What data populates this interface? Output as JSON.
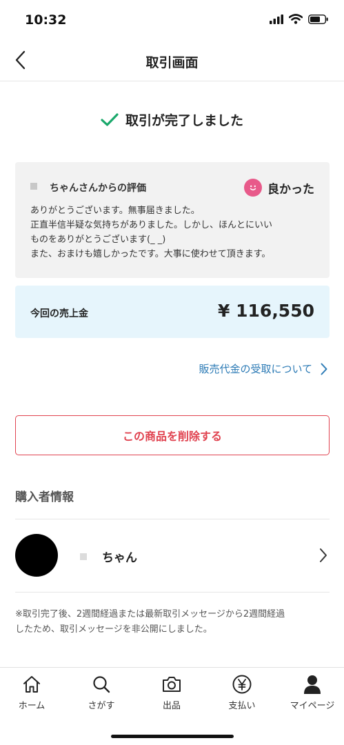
{
  "status_bar": {
    "time": "10:32"
  },
  "header": {
    "title": "取引画面"
  },
  "completion": {
    "message": "取引が完了しました"
  },
  "review": {
    "from": "ちゃんさんからの評価",
    "rating": "良かった",
    "lines": [
      "ありがとうございます。無事届きました。",
      "正直半信半疑な気持ちがありました。しかし、ほんとにいい",
      "ものをありがとうございます(_ _)",
      "また、おまけも嬉しかったです。大事に使わせて頂きます。"
    ]
  },
  "sales": {
    "label": "今回の売上金",
    "amount": "¥ 116,550"
  },
  "payout_link": {
    "label": "販売代金の受取について"
  },
  "delete_button": {
    "label": "この商品を削除する"
  },
  "buyer": {
    "heading": "購入者情報",
    "name": "ちゃん"
  },
  "notice": {
    "lines": [
      "※取引完了後、2週間経過または最新取引メッセージから2週間経過",
      "したため、取引メッセージを非公開にしました。"
    ]
  },
  "tab_bar": {
    "items": [
      {
        "label": "ホーム",
        "icon": "home-icon"
      },
      {
        "label": "さがす",
        "icon": "search-icon"
      },
      {
        "label": "出品",
        "icon": "camera-icon"
      },
      {
        "label": "支払い",
        "icon": "yen-icon"
      },
      {
        "label": "マイページ",
        "icon": "person-icon"
      }
    ]
  },
  "colors": {
    "check": "#1aa86b",
    "accent_red": "#e0424f",
    "link_blue": "#2b7ab5",
    "smile_pink": "#e85a8a",
    "sales_bg": "#e6f5fc",
    "review_bg": "#f2f2f2"
  }
}
